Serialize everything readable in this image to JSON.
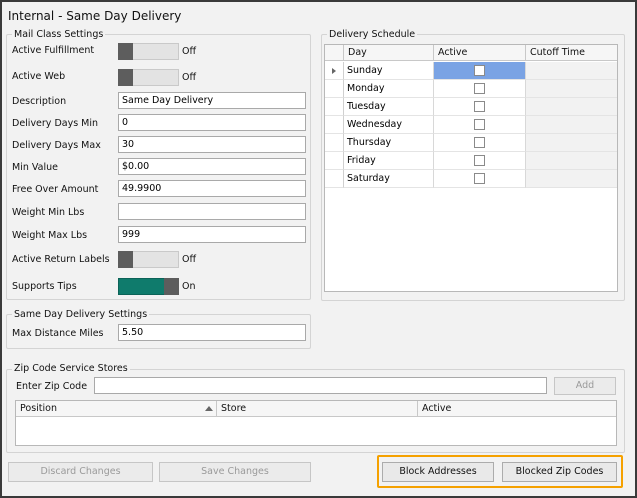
{
  "window": {
    "title": "Internal - Same Day Delivery"
  },
  "mail_class": {
    "legend": "Mail Class Settings",
    "active_fulfillment": {
      "label": "Active Fulfillment",
      "state": "Off"
    },
    "active_web": {
      "label": "Active Web",
      "state": "Off"
    },
    "description": {
      "label": "Description",
      "value": "Same Day Delivery"
    },
    "delivery_days_min": {
      "label": "Delivery Days Min",
      "value": "0"
    },
    "delivery_days_max": {
      "label": "Delivery Days Max",
      "value": "30"
    },
    "min_value": {
      "label": "Min Value",
      "value": "$0.00"
    },
    "free_over_amount": {
      "label": "Free Over Amount",
      "value": "49.9900"
    },
    "weight_min": {
      "label": "Weight Min Lbs",
      "value": ""
    },
    "weight_max": {
      "label": "Weight Max Lbs",
      "value": "999"
    },
    "active_return_labels": {
      "label": "Active Return Labels",
      "state": "Off"
    },
    "supports_tips": {
      "label": "Supports Tips",
      "state": "On"
    }
  },
  "same_day": {
    "legend": "Same Day Delivery Settings",
    "max_distance": {
      "label": "Max Distance Miles",
      "value": "5.50"
    }
  },
  "delivery_schedule": {
    "legend": "Delivery Schedule",
    "columns": [
      "Day",
      "Active",
      "Cutoff Time"
    ],
    "rows": [
      {
        "day": "Sunday",
        "active": false,
        "cutoff": ""
      },
      {
        "day": "Monday",
        "active": false,
        "cutoff": ""
      },
      {
        "day": "Tuesday",
        "active": false,
        "cutoff": ""
      },
      {
        "day": "Wednesday",
        "active": false,
        "cutoff": ""
      },
      {
        "day": "Thursday",
        "active": false,
        "cutoff": ""
      },
      {
        "day": "Friday",
        "active": false,
        "cutoff": ""
      },
      {
        "day": "Saturday",
        "active": false,
        "cutoff": ""
      }
    ]
  },
  "zip_stores": {
    "legend": "Zip Code Service Stores",
    "enter_zip_label": "Enter Zip Code",
    "enter_zip_value": "",
    "add_label": "Add",
    "columns": [
      "Position",
      "Store",
      "Active"
    ]
  },
  "footer": {
    "discard": "Discard Changes",
    "save": "Save Changes",
    "block_addresses": "Block Addresses",
    "blocked_zip_codes": "Blocked Zip Codes"
  },
  "colors": {
    "toggle_on": "#0f7b6c",
    "selected_cell": "#7aa3e4",
    "highlight": "#f5a100"
  }
}
